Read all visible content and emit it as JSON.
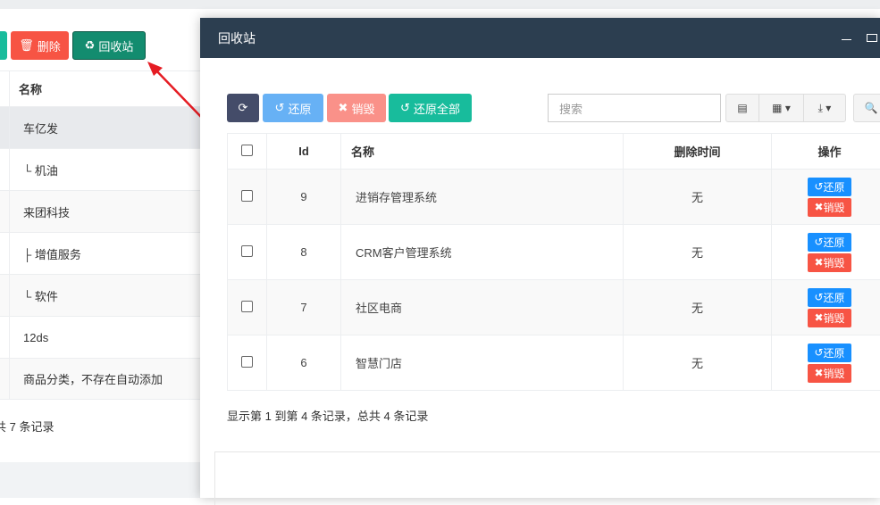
{
  "page": {
    "buttons": {
      "delete": "删除",
      "recycle": "回收站"
    },
    "table": {
      "header": "名称",
      "rows": [
        "车亿发",
        "└ 机油",
        "来团科技",
        "├ 增值服务",
        "└ 软件",
        "12ds",
        "商品分类，不存在自动添加"
      ]
    },
    "footer": "共 7 条记录"
  },
  "modal": {
    "title": "回收站",
    "toolbar": {
      "restore": "还原",
      "destroy": "销毁",
      "restore_all": "还原全部",
      "search_placeholder": "搜索"
    },
    "columns": [
      "Id",
      "名称",
      "删除时间",
      "操作"
    ],
    "rows": [
      {
        "id": "9",
        "name": "进销存管理系统",
        "time": "无"
      },
      {
        "id": "8",
        "name": "CRM客户管理系统",
        "time": "无"
      },
      {
        "id": "7",
        "name": "社区电商",
        "time": "无"
      },
      {
        "id": "6",
        "name": "智慧门店",
        "time": "无"
      }
    ],
    "row_actions": {
      "restore": "还原",
      "destroy": "销毁"
    },
    "footer": "显示第 1 到第 4 条记录，总共 4 条记录"
  },
  "colors": {
    "header": "#2c3e50",
    "danger": "#f75444",
    "primary": "#1890ff",
    "teal": "#18bc9c",
    "recycle": "#138c6f"
  }
}
